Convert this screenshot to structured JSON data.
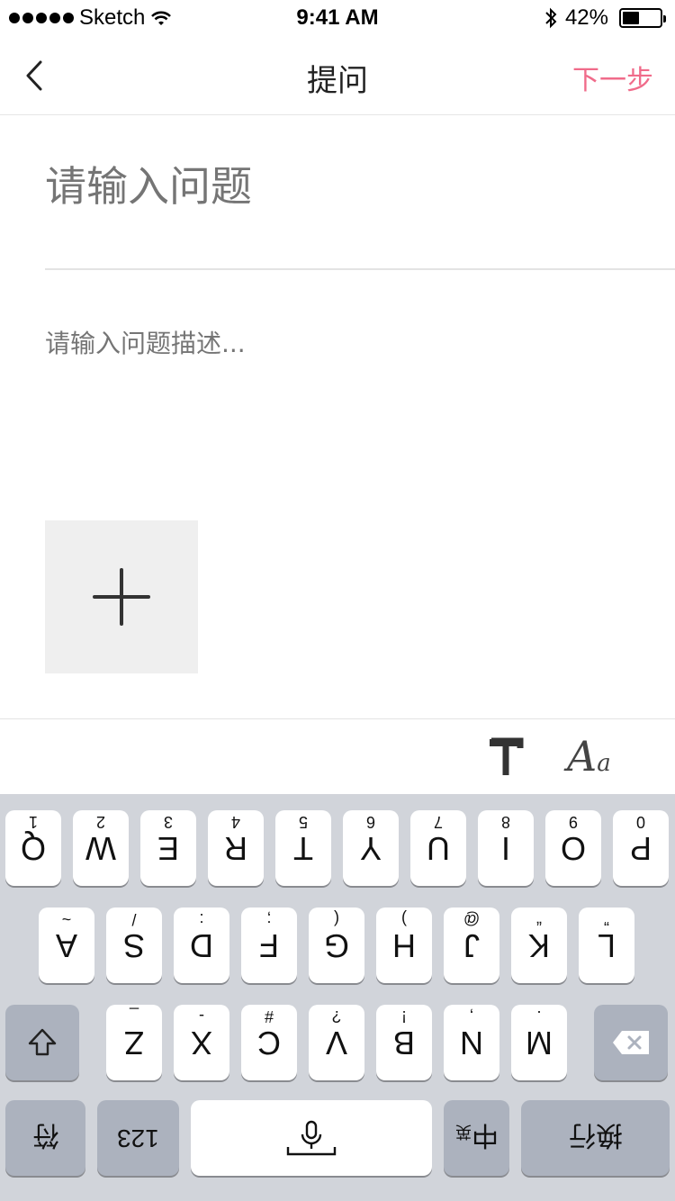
{
  "status_bar": {
    "carrier": "Sketch",
    "time": "9:41 AM",
    "battery_percent": "42%",
    "battery_level": 0.42,
    "icons": [
      "signal-dots-icon",
      "wifi-icon",
      "bluetooth-icon",
      "battery-icon"
    ]
  },
  "nav": {
    "back_icon": "chevron-left-icon",
    "title": "提问",
    "next_label": "下一步",
    "next_color": "#f06b8a"
  },
  "form": {
    "title_placeholder": "请输入问题",
    "description_placeholder": "请输入问题描述...",
    "add_image_icon": "plus-icon"
  },
  "toolbar": {
    "bold_icon": "text-bold-icon",
    "font_icon_big": "A",
    "font_icon_small": "a"
  },
  "keyboard": {
    "row1": [
      {
        "main": "Q",
        "sub": "1"
      },
      {
        "main": "W",
        "sub": "2"
      },
      {
        "main": "E",
        "sub": "3"
      },
      {
        "main": "R",
        "sub": "4"
      },
      {
        "main": "T",
        "sub": "5"
      },
      {
        "main": "Y",
        "sub": "6"
      },
      {
        "main": "U",
        "sub": "7"
      },
      {
        "main": "I",
        "sub": "8"
      },
      {
        "main": "O",
        "sub": "9"
      },
      {
        "main": "P",
        "sub": "0"
      }
    ],
    "row2": [
      {
        "main": "A",
        "sub": "~"
      },
      {
        "main": "S",
        "sub": "/"
      },
      {
        "main": "D",
        "sub": ":"
      },
      {
        "main": "F",
        "sub": ";"
      },
      {
        "main": "G",
        "sub": "("
      },
      {
        "main": "H",
        "sub": ")"
      },
      {
        "main": "J",
        "sub": "@"
      },
      {
        "main": "K",
        "sub": "“"
      },
      {
        "main": "L",
        "sub": "”"
      }
    ],
    "row3": [
      {
        "main": "Z",
        "sub": "_"
      },
      {
        "main": "X",
        "sub": "-"
      },
      {
        "main": "C",
        "sub": "#"
      },
      {
        "main": "V",
        "sub": "?"
      },
      {
        "main": "B",
        "sub": "!"
      },
      {
        "main": "N",
        "sub": ","
      },
      {
        "main": "M",
        "sub": "."
      }
    ],
    "shift_icon": "shift-icon",
    "delete_icon": "backspace-icon",
    "emoji_label": "符",
    "numbers_label": "123",
    "mic_icon": "microphone-icon",
    "lang_label_main": "中",
    "lang_label_sub": "英",
    "return_label": "换行"
  }
}
